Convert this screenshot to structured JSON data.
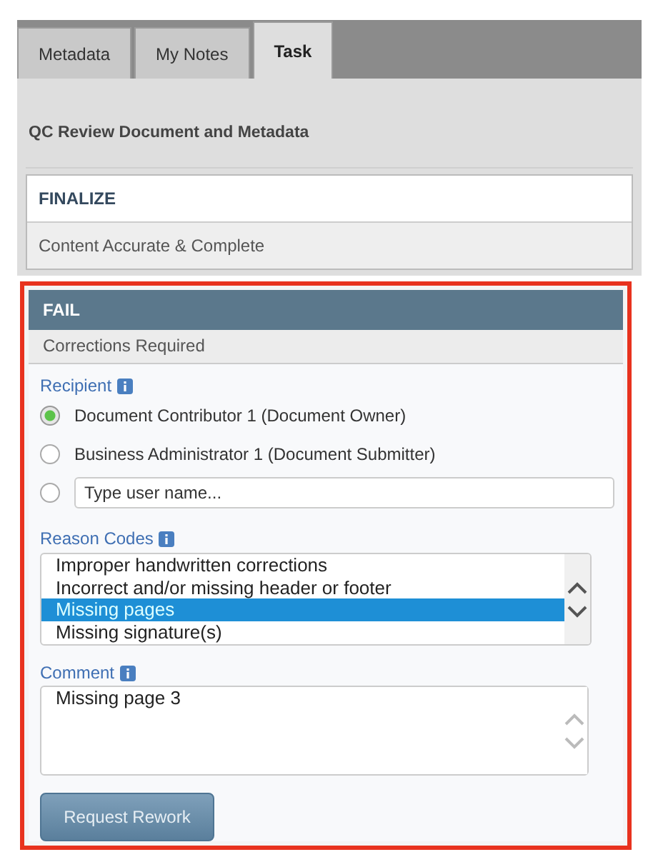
{
  "tabs": [
    {
      "label": "Metadata",
      "selected": false
    },
    {
      "label": "My Notes",
      "selected": false
    },
    {
      "label": "Task",
      "selected": true
    }
  ],
  "task_title": "QC Review Document and Metadata",
  "finalize": {
    "title": "FINALIZE",
    "subtitle": "Content Accurate & Complete"
  },
  "fail": {
    "title": "FAIL",
    "subtitle": "Corrections Required",
    "recipient": {
      "label": "Recipient",
      "options": [
        {
          "kind": "label",
          "label": "Document Contributor 1 (Document Owner)",
          "selected": true
        },
        {
          "kind": "label",
          "label": "Business Administrator 1 (Document Submitter)",
          "selected": false
        },
        {
          "kind": "input",
          "placeholder": "Type user name...",
          "selected": false
        }
      ]
    },
    "reason_codes": {
      "label": "Reason Codes",
      "options": [
        {
          "label": "Improper handwritten corrections",
          "selected": false
        },
        {
          "label": "Incorrect and/or missing header or footer",
          "selected": false
        },
        {
          "label": "Missing pages",
          "selected": true
        },
        {
          "label": "Missing signature(s)",
          "selected": false
        }
      ]
    },
    "comment": {
      "label": "Comment",
      "value": "Missing page 3"
    },
    "button": "Request Rework"
  }
}
